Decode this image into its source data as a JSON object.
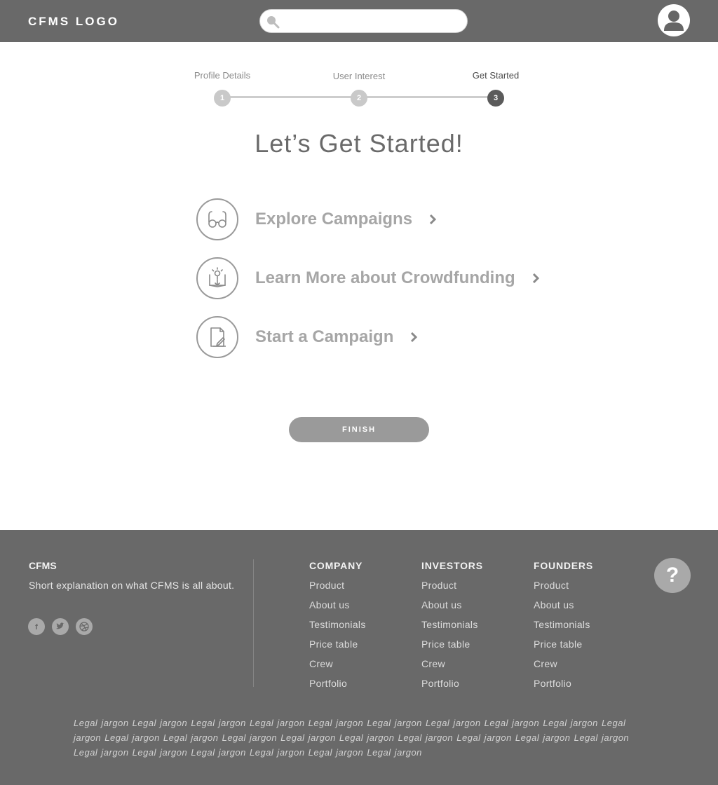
{
  "header": {
    "logo": "CFMS LOGO",
    "search": {
      "placeholder": "",
      "value": ""
    }
  },
  "stepper": {
    "steps": [
      {
        "label": "Profile Details",
        "number": "1",
        "state": "completed"
      },
      {
        "label": "User Interest",
        "number": "2",
        "state": "completed"
      },
      {
        "label": "Get Started",
        "number": "3",
        "state": "active"
      }
    ]
  },
  "main": {
    "title": "Let’s Get Started!",
    "options": [
      {
        "label": "Explore Campaigns",
        "icon": "glasses-icon"
      },
      {
        "label": "Learn More about Crowdfunding",
        "icon": "lightbulb-book-icon"
      },
      {
        "label": "Start a Campaign",
        "icon": "document-edit-icon"
      }
    ],
    "finish_label": "FINISH"
  },
  "footer": {
    "brand": "CFMS",
    "description": "Short explanation on what CFMS is all about.",
    "social": [
      "facebook-icon",
      "twitter-icon",
      "dribbble-icon"
    ],
    "columns": [
      {
        "heading": "COMPANY",
        "links": [
          "Product",
          "About us",
          "Testimonials",
          "Price table",
          "Crew",
          "Portfolio"
        ]
      },
      {
        "heading": "INVESTORS",
        "links": [
          "Product",
          "About us",
          "Testimonials",
          "Price table",
          "Crew",
          "Portfolio"
        ]
      },
      {
        "heading": "FOUNDERS",
        "links": [
          "Product",
          "About us",
          "Testimonials",
          "Price table",
          "Crew",
          "Portfolio"
        ]
      }
    ],
    "help_label": "?",
    "legal": "Legal jargon Legal jargon Legal jargon Legal jargon Legal jargon Legal jargon Legal jargon Legal jargon Legal jargon Legal jargon Legal jargon Legal jargon Legal jargon Legal jargon Legal jargon Legal jargon Legal jargon Legal jargon Legal jargon Legal jargon Legal jargon Legal jargon Legal jargon Legal jargon Legal jargon"
  },
  "colors": {
    "header_bg": "#696969",
    "footer_bg": "#696969",
    "active_step": "#5b5b5b",
    "inactive_step": "#c9c9c9",
    "option_text": "#a6a6a6",
    "button_bg": "#9a9a9a"
  }
}
